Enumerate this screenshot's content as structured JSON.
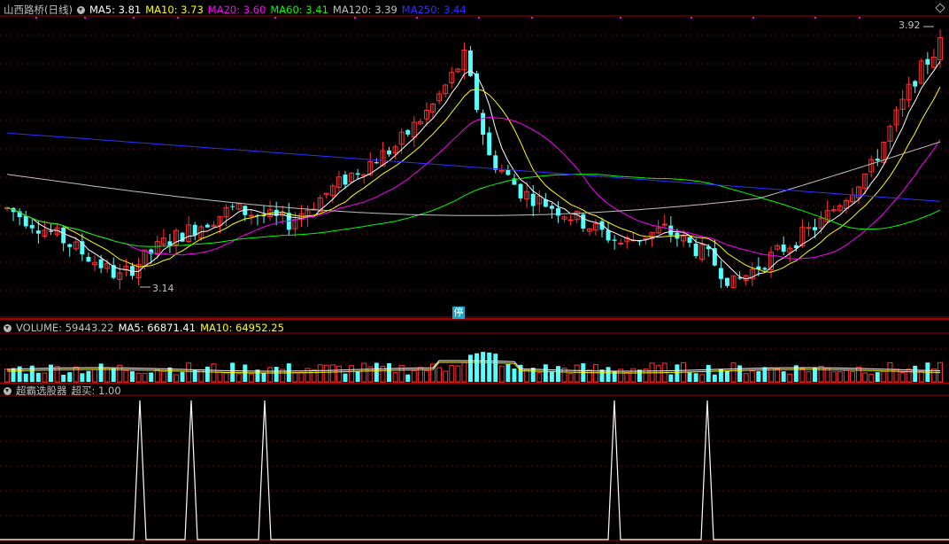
{
  "header": {
    "title": "山西路桥(日线)",
    "ma_items": [
      {
        "label": "MA5: 3.81",
        "color": "#ffffff"
      },
      {
        "label": "MA10: 3.73",
        "color": "#ffff00"
      },
      {
        "label": "MA20: 3.60",
        "color": "#ff00ff"
      },
      {
        "label": "MA60: 3.41",
        "color": "#00ff00"
      },
      {
        "label": "MA120: 3.39",
        "color": "#c0c0c0"
      },
      {
        "label": "MA250: 3.44",
        "color": "#3030ff"
      }
    ]
  },
  "price_annotations": {
    "high": "3.92",
    "low": "3.14"
  },
  "halt_marker": "停",
  "volume_header": {
    "items": [
      {
        "label": "VOLUME: 59443.22",
        "color": "#c0c0c0"
      },
      {
        "label": "MA5: 66871.41",
        "color": "#ffffff"
      },
      {
        "label": "MA10: 64952.25",
        "color": "#ffff00"
      }
    ]
  },
  "indicator_header": {
    "items": [
      {
        "label": "超霸选股器",
        "color": "#c0c0c0"
      },
      {
        "label": "超买: 1.00",
        "color": "#c0c0c0"
      }
    ]
  },
  "colors": {
    "up": "#ff3232",
    "down": "#54ffff",
    "grid": "#7a0000",
    "border": "#a00000"
  },
  "chart_data": {
    "type": "candlestick",
    "title": "山西路桥(日线)",
    "price_range": [
      3.1,
      3.95
    ],
    "visible_price_labels": {
      "high": 3.92,
      "low": 3.14
    },
    "series": [
      {
        "name": "MA5",
        "last": 3.81
      },
      {
        "name": "MA10",
        "last": 3.73
      },
      {
        "name": "MA20",
        "last": 3.6
      },
      {
        "name": "MA60",
        "last": 3.41
      },
      {
        "name": "MA120",
        "last": 3.39
      },
      {
        "name": "MA250",
        "last": 3.44
      }
    ],
    "volume": {
      "last": 59443.22,
      "ma5": 66871.41,
      "ma10": 64952.25
    },
    "indicator": {
      "name": "超霸选股器",
      "超买": 1.0,
      "signal_count": 5
    }
  }
}
